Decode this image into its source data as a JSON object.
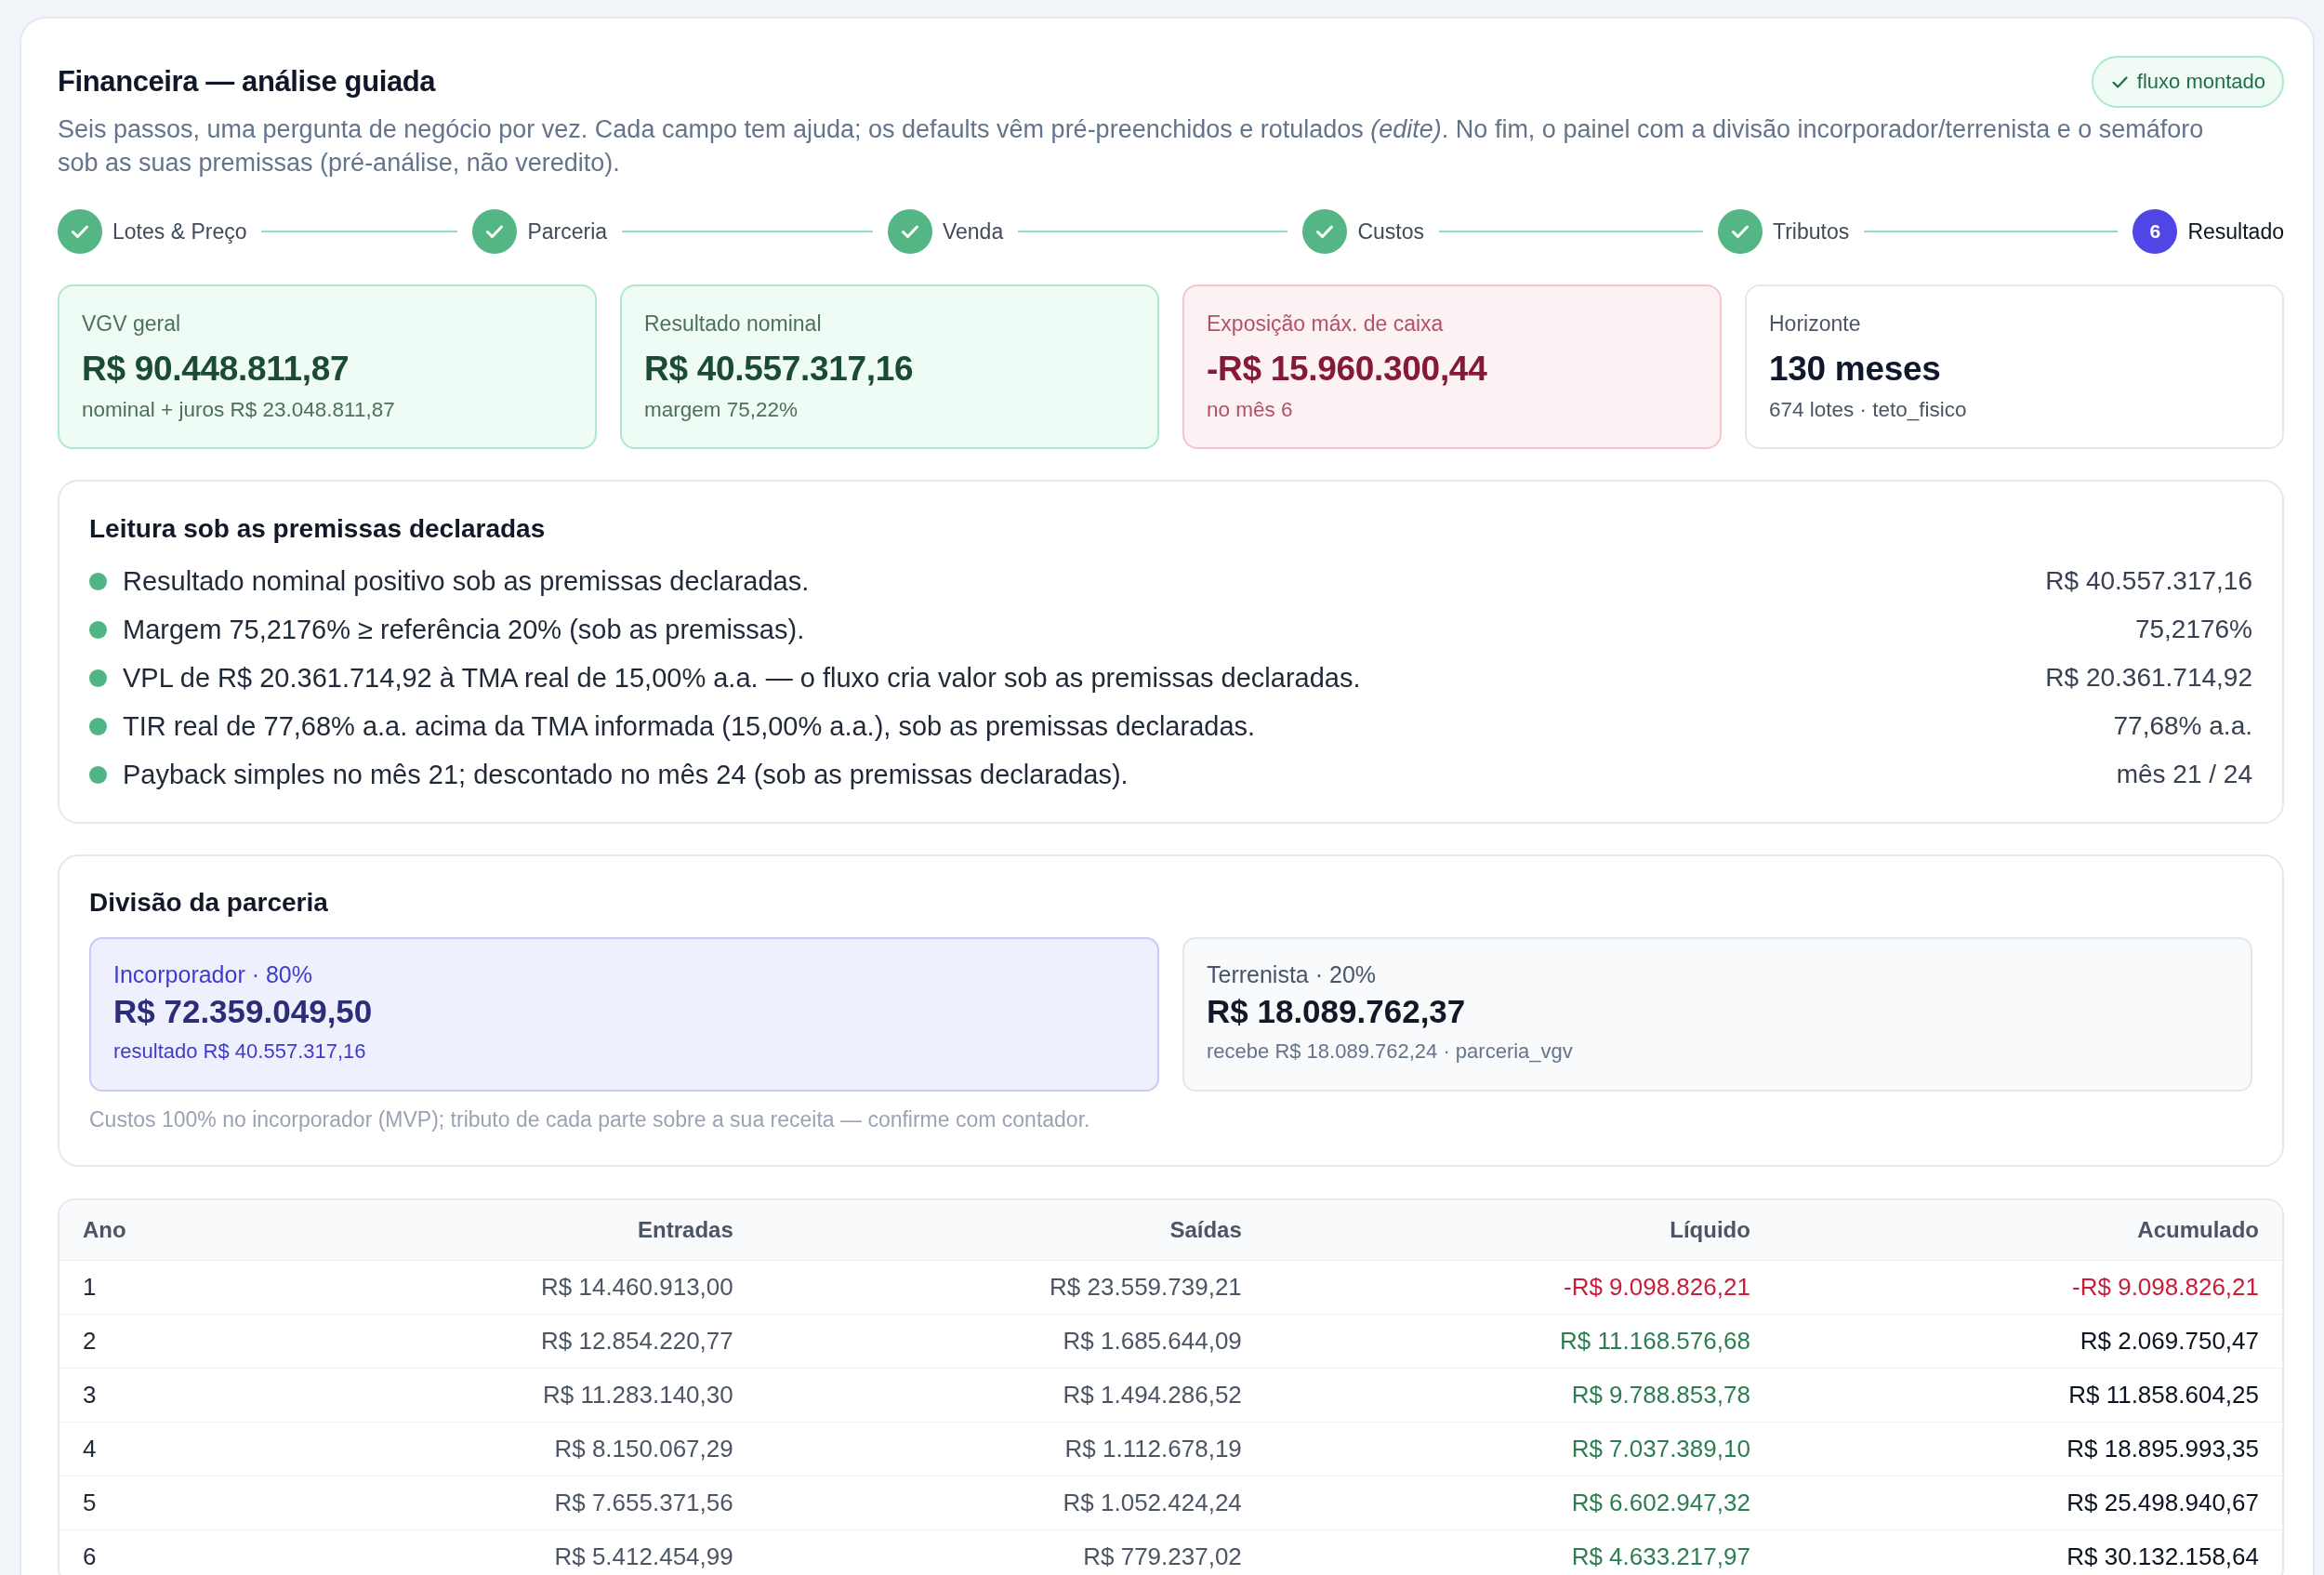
{
  "title": "Financeira — análise guiada",
  "badge": "fluxo montado",
  "description": "Seis passos, uma pergunta de negócio por vez. Cada campo tem ajuda; os defaults vêm pré-preenchidos e rotulados *(edite)*. No fim, o painel com a divisão incorporador/terrenista e o semáforo sob as suas premissas (pré-análise, não veredito).",
  "steps": [
    {
      "label": "Lotes & Preço",
      "done": true,
      "selected": false
    },
    {
      "label": "Parceria",
      "done": true,
      "selected": false
    },
    {
      "label": "Venda",
      "done": true,
      "selected": false
    },
    {
      "label": "Custos",
      "done": true,
      "selected": false
    },
    {
      "label": "Tributos",
      "done": true,
      "selected": false
    },
    {
      "label": "Resultado",
      "number": "6",
      "done": false,
      "selected": true
    }
  ],
  "kpis": [
    {
      "label": "VGV geral",
      "value": "R$ 90.448.811,87",
      "note": "nominal + juros R$ 23.048.811,87",
      "kind": "positive"
    },
    {
      "label": "Resultado nominal",
      "value": "R$ 40.557.317,16",
      "note": "margem 75,22%",
      "kind": "positive"
    },
    {
      "label": "Exposição máx. de caixa",
      "value": "-R$ 15.960.300,44",
      "note": "no mês 6",
      "kind": "negative"
    },
    {
      "label": "Horizonte",
      "value": "130 meses",
      "note": "674 lotes · teto_fisico",
      "kind": "neutral"
    }
  ],
  "reading": {
    "title": "Leitura sob as premissas declaradas",
    "items": [
      {
        "text": "Resultado nominal positivo sob as premissas declaradas.",
        "value": "R$ 40.557.317,16",
        "color": "#4fb583"
      },
      {
        "text": "Margem 75,2176% ≥ referência 20% (sob as premissas).",
        "value": "75,2176%",
        "color": "#4fb583"
      },
      {
        "text": "VPL de R$ 20.361.714,92 à TMA real de 15,00% a.a. — o fluxo cria valor sob as premissas declaradas.",
        "value": "R$ 20.361.714,92",
        "color": "#4fb583"
      },
      {
        "text": "TIR real de 77,68% a.a. acima da TMA informada (15,00% a.a.), sob as premissas declaradas.",
        "value": "77,68% a.a.",
        "color": "#4fb583"
      },
      {
        "text": "Payback simples no mês 21; descontado no mês 24 (sob as premissas declaradas).",
        "value": "mês 21 / 24",
        "color": "#4fb583"
      }
    ]
  },
  "partnership": {
    "title": "Divisão da parceria",
    "parties": [
      {
        "label": "Incorporador · 80%",
        "value": "R$ 72.359.049,50",
        "note": "resultado R$ 40.557.317,16",
        "highlighted": true
      },
      {
        "label": "Terrenista · 20%",
        "value": "R$ 18.089.762,37",
        "note": "recebe R$ 18.089.762,24 · parceria_vgv",
        "highlighted": false
      }
    ],
    "footnote": "Custos 100% no incorporador (MVP); tributo de cada parte sobre a sua receita — confirme com contador."
  },
  "cash_flow": {
    "columns": [
      "Ano",
      "Entradas",
      "Saídas",
      "Líquido",
      "Acumulado"
    ],
    "rows": [
      {
        "ano": "1",
        "entradas": "R$ 14.460.913,00",
        "saidas": "R$ 23.559.739,21",
        "liquido": {
          "value": "-R$ 9.098.826,21",
          "negative": true
        },
        "acumulado": {
          "value": "-R$ 9.098.826,21",
          "negative": true
        }
      },
      {
        "ano": "2",
        "entradas": "R$ 12.854.220,77",
        "saidas": "R$ 1.685.644,09",
        "liquido": {
          "value": "R$ 11.168.576,68",
          "negative": false
        },
        "acumulado": {
          "value": "R$ 2.069.750,47",
          "negative": false
        }
      },
      {
        "ano": "3",
        "entradas": "R$ 11.283.140,30",
        "saidas": "R$ 1.494.286,52",
        "liquido": {
          "value": "R$ 9.788.853,78",
          "negative": false
        },
        "acumulado": {
          "value": "R$ 11.858.604,25",
          "negative": false
        }
      },
      {
        "ano": "4",
        "entradas": "R$ 8.150.067,29",
        "saidas": "R$ 1.112.678,19",
        "liquido": {
          "value": "R$ 7.037.389,10",
          "negative": false
        },
        "acumulado": {
          "value": "R$ 18.895.993,35",
          "negative": false
        }
      },
      {
        "ano": "5",
        "entradas": "R$ 7.655.371,56",
        "saidas": "R$ 1.052.424,24",
        "liquido": {
          "value": "R$ 6.602.947,32",
          "negative": false
        },
        "acumulado": {
          "value": "R$ 25.498.940,67",
          "negative": false
        }
      },
      {
        "ano": "6",
        "entradas": "R$ 5.412.454,99",
        "saidas": "R$ 779.237,02",
        "liquido": {
          "value": "R$ 4.633.217,97",
          "negative": false
        },
        "acumulado": {
          "value": "R$ 30.132.158,64",
          "negative": false
        }
      }
    ]
  }
}
